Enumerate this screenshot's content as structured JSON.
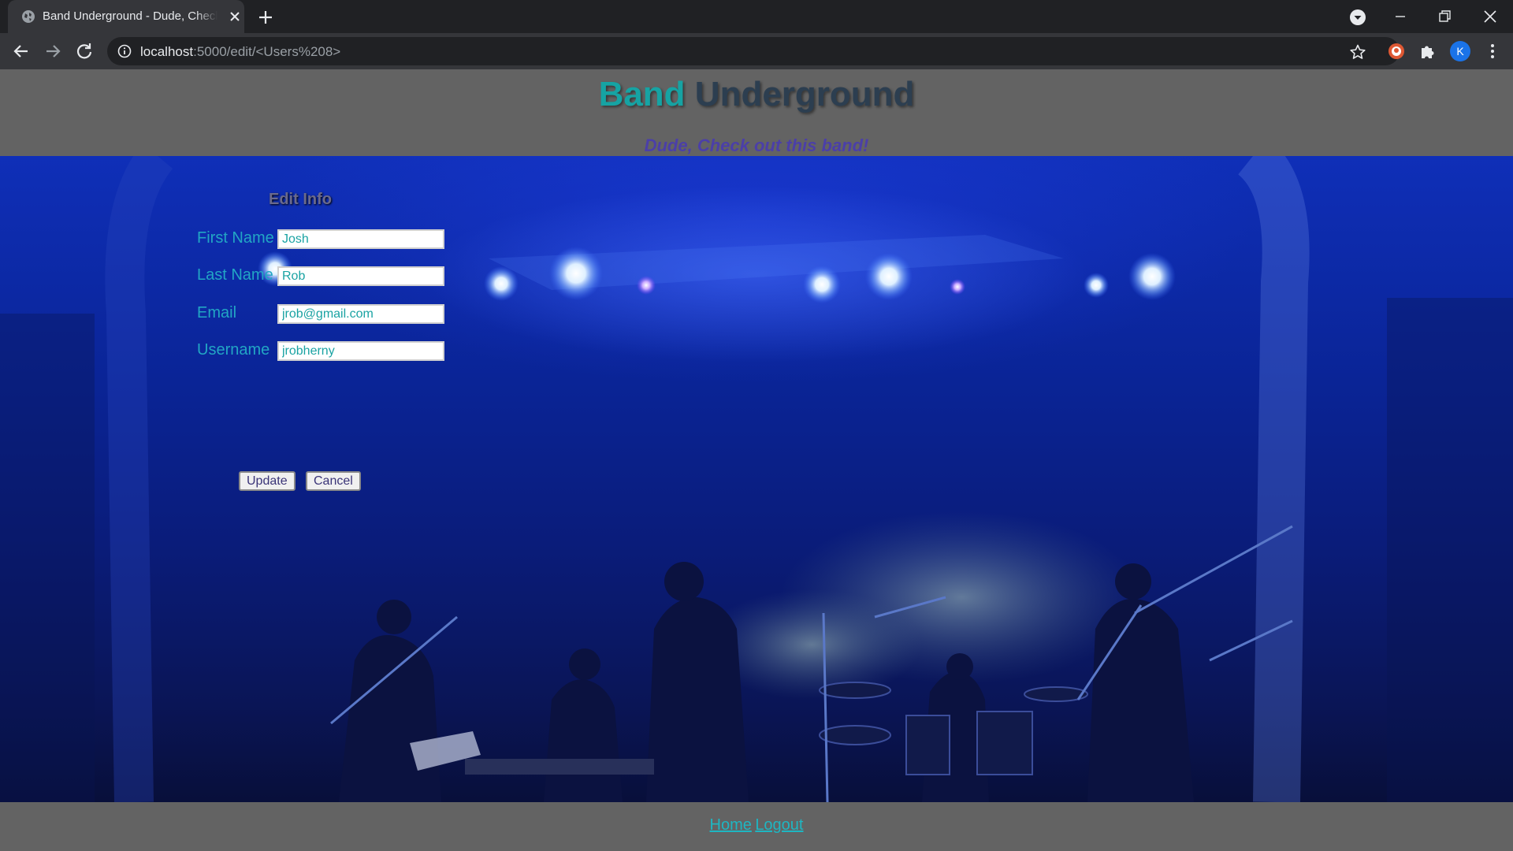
{
  "browser": {
    "tab_title": "Band Underground - Dude, Check out this band!",
    "url_host": "localhost",
    "url_path": ":5000/edit/<Users%208>",
    "profile_initial": "K",
    "icons": {
      "favicon": "globe-icon",
      "close": "close-icon",
      "new_tab": "plus-icon",
      "back": "back-arrow-icon",
      "forward": "forward-arrow-icon",
      "reload": "reload-icon",
      "info": "info-icon",
      "bookmark": "star-icon",
      "extension1": "duckduckgo-icon",
      "extension2": "puzzle-icon",
      "menu": "kebab-menu-icon"
    }
  },
  "site": {
    "brand_accent": "Band",
    "brand_rest": "Underground",
    "tagline": "Dude, Check out this band!"
  },
  "form": {
    "title": "Edit Info",
    "fields": [
      {
        "label": "First Name",
        "value": "Josh"
      },
      {
        "label": "Last Name",
        "value": "Rob"
      },
      {
        "label": "Email",
        "value": "jrob@gmail.com"
      },
      {
        "label": "Username",
        "value": "jrobherny"
      }
    ],
    "update_label": "Update",
    "cancel_label": "Cancel"
  },
  "footer": {
    "home_label": "Home",
    "logout_label": "Logout"
  },
  "colors": {
    "brand_accent": "#16a3a3",
    "brand_text": "#2c3e50",
    "tagline": "#4b3fa8",
    "label": "#22a6c4",
    "link": "#1eb6c2"
  }
}
